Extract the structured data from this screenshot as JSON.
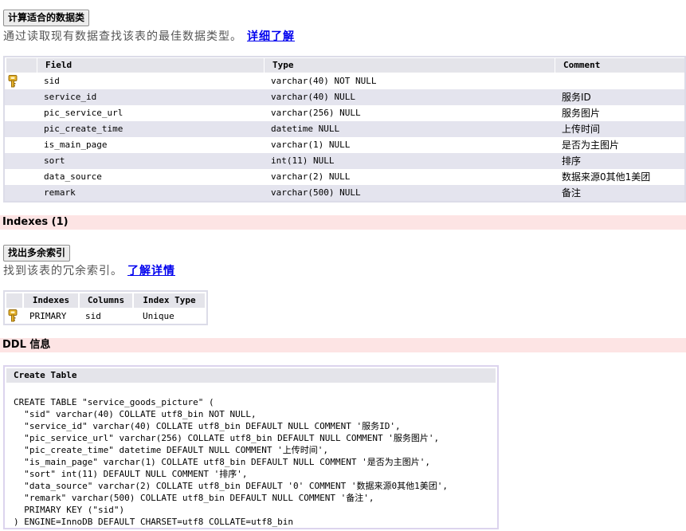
{
  "optimize": {
    "button_label": "计算适合的数据类",
    "description": "通过读取现有数据查找该表的最佳数据类型。",
    "link_label": "详细了解"
  },
  "fields": {
    "headers": [
      "Field",
      "Type",
      "Comment"
    ],
    "rows": [
      {
        "field": "sid",
        "type": "varchar(40) NOT NULL",
        "comment": "",
        "primary_key": true
      },
      {
        "field": "service_id",
        "type": "varchar(40) NULL",
        "comment": "服务ID"
      },
      {
        "field": "pic_service_url",
        "type": "varchar(256) NULL",
        "comment": "服务图片"
      },
      {
        "field": "pic_create_time",
        "type": "datetime NULL",
        "comment": "上传时间"
      },
      {
        "field": "is_main_page",
        "type": "varchar(1) NULL",
        "comment": "是否为主图片"
      },
      {
        "field": "sort",
        "type": "int(11) NULL",
        "comment": "排序"
      },
      {
        "field": "data_source",
        "type": "varchar(2) NULL",
        "comment": "数据来源0其他1美团"
      },
      {
        "field": "remark",
        "type": "varchar(500) NULL",
        "comment": "备注"
      }
    ]
  },
  "indexes_section": {
    "title": "Indexes (1)"
  },
  "redundant": {
    "button_label": "找出多余索引",
    "description": "找到该表的冗余索引。",
    "link_label": "了解详情"
  },
  "indexes": {
    "headers": [
      "Indexes",
      "Columns",
      "Index Type"
    ],
    "rows": [
      {
        "name": "PRIMARY",
        "columns": "sid",
        "type": "Unique",
        "primary_key": true
      }
    ]
  },
  "ddl_section": {
    "title": "DDL 信息"
  },
  "ddl": {
    "header": "Create Table",
    "lines": [
      "CREATE TABLE \"service_goods_picture\" (",
      "  \"sid\" varchar(40) COLLATE utf8_bin NOT NULL,",
      "  \"service_id\" varchar(40) COLLATE utf8_bin DEFAULT NULL COMMENT '服务ID',",
      "  \"pic_service_url\" varchar(256) COLLATE utf8_bin DEFAULT NULL COMMENT '服务图片',",
      "  \"pic_create_time\" datetime DEFAULT NULL COMMENT '上传时间',",
      "  \"is_main_page\" varchar(1) COLLATE utf8_bin DEFAULT NULL COMMENT '是否为主图片',",
      "  \"sort\" int(11) DEFAULT NULL COMMENT '排序',",
      "  \"data_source\" varchar(2) COLLATE utf8_bin DEFAULT '0' COMMENT '数据来源0其他1美团',",
      "  \"remark\" varchar(500) COLLATE utf8_bin DEFAULT NULL COMMENT '备注',",
      "  PRIMARY KEY (\"sid\")",
      ") ENGINE=InnoDB DEFAULT CHARSET=utf8 COLLATE=utf8_bin"
    ]
  },
  "colors": {
    "section_bg": "#fde4e4",
    "header_bg": "#e4e4ea",
    "row_alt_bg": "#e4e4ee",
    "link": "#0000ee",
    "key_icon": "#d4a017"
  },
  "icons": {
    "primary_key": "key-icon"
  }
}
